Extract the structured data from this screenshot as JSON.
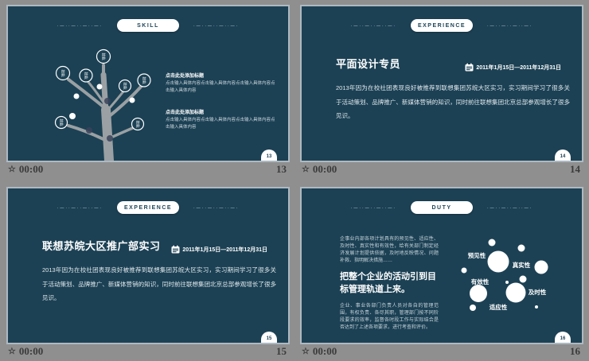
{
  "common": {
    "deco_text": "·—··—··—··—·",
    "star_icon": "☆",
    "time": "00:00"
  },
  "slides": [
    {
      "tab": "SKILL",
      "page": "13",
      "tree_nodes": [
        {
          "label": "技能"
        },
        {
          "label": "技能"
        },
        {
          "label": "技能"
        },
        {
          "label": "技能"
        },
        {
          "label": "技能"
        },
        {
          "label": "技能"
        },
        {
          "label": "技能"
        }
      ],
      "blocks": [
        {
          "heading": "点击此处添加标题",
          "body": "点击输入具体内容点击输入具体内容点击输入具体内容点击输入具体内容"
        },
        {
          "heading": "点击此处添加标题",
          "body": "点击输入具体内容点击输入具体内容点击输入具体内容点击输入具体内容"
        }
      ]
    },
    {
      "tab": "EXPERIENCE",
      "page": "14",
      "title": "平面设计专员",
      "date": "2011年1月15日—2011年12月31日",
      "body": "2013年因为在校社团表现良好被推荐到联想集团苏皖大区实习，实习期间学习了很多关于活动策划、品牌推广、新媒体营销的知识，同时前往联想集团北京总部参观增长了很多见识。"
    },
    {
      "tab": "EXPERIENCE",
      "page": "15",
      "title": "联想苏皖大区推广部实习",
      "date": "2011年1月15日—2011年12月31日",
      "body": "2013年因为在校社团表现良好被推荐到联想集团苏皖大区实习，实习期间学习了很多关于活动策划、品牌推广、新媒体营销的知识，同时前往联想集团北京总部参观增长了很多见识。"
    },
    {
      "tab": "DUTY",
      "page": "16",
      "para1": "企事业内部各项计划具有的预见性、适应性、及时性、真实性和有效性，给有关部门制定经济发展计划提供依据，及时地反映情况、问题补救、指明解决措施……",
      "heading": "把整个企业的活动引到目标管理轨道上来。",
      "para2": "企业、事业各部门负责人员对各自的管理范围，有权负责、各尽其职，管理部门按不同阶段要求的效率，监督各时段工作与实际结合是否达到了上述各项要求，进行考查和评价。",
      "bubbles": [
        {
          "label": "预见性"
        },
        {
          "label": "真实性"
        },
        {
          "label": "有效性"
        },
        {
          "label": "及时性"
        },
        {
          "label": "适应性"
        }
      ]
    }
  ]
}
